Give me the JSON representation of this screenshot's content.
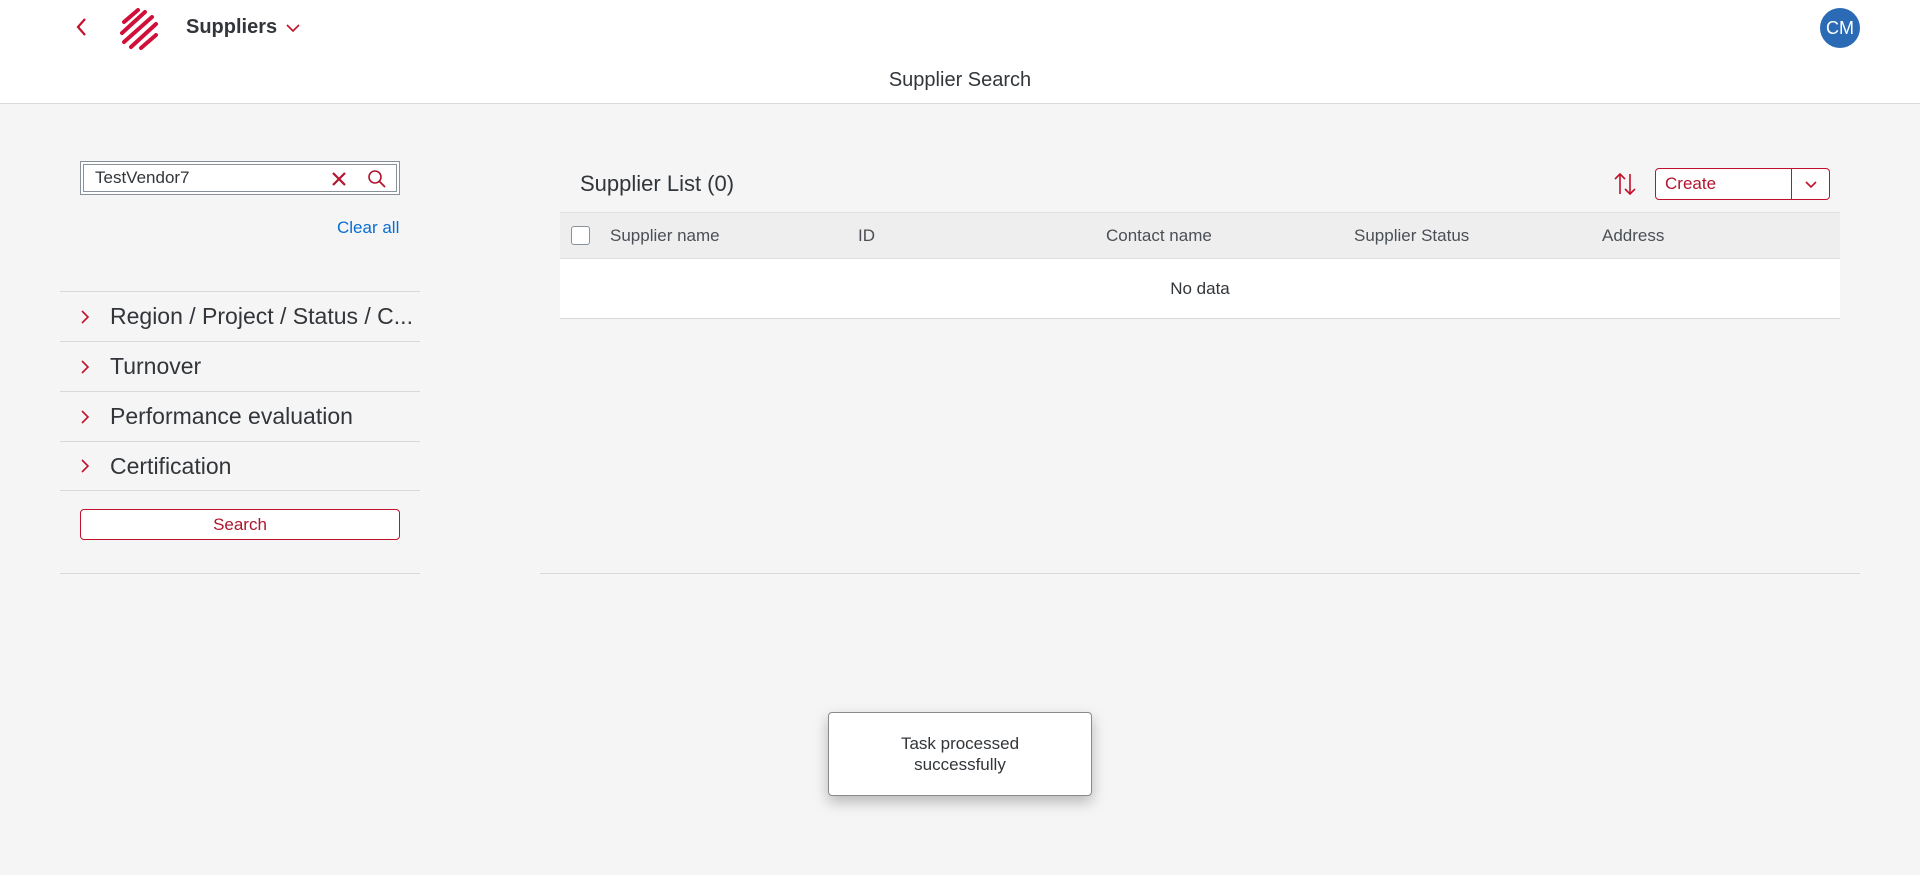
{
  "header": {
    "app_title": "Suppliers",
    "avatar_initials": "CM",
    "page_title": "Supplier Search"
  },
  "filters": {
    "search_value": "TestVendor7",
    "clear_all_label": "Clear all",
    "groups": [
      {
        "label": "Region / Project / Status / C..."
      },
      {
        "label": "Turnover"
      },
      {
        "label": "Performance evaluation"
      },
      {
        "label": "Certification"
      }
    ],
    "search_button_label": "Search"
  },
  "list": {
    "title": "Supplier List (0)",
    "create_label": "Create",
    "columns": [
      "Supplier name",
      "ID",
      "Contact name",
      "Supplier Status",
      "Address"
    ],
    "empty_text": "No data"
  },
  "toast": {
    "message": "Task processed successfully"
  },
  "colors": {
    "accent": "#c0122c",
    "link": "#0a6ed1",
    "avatar": "#2b6bb5"
  }
}
